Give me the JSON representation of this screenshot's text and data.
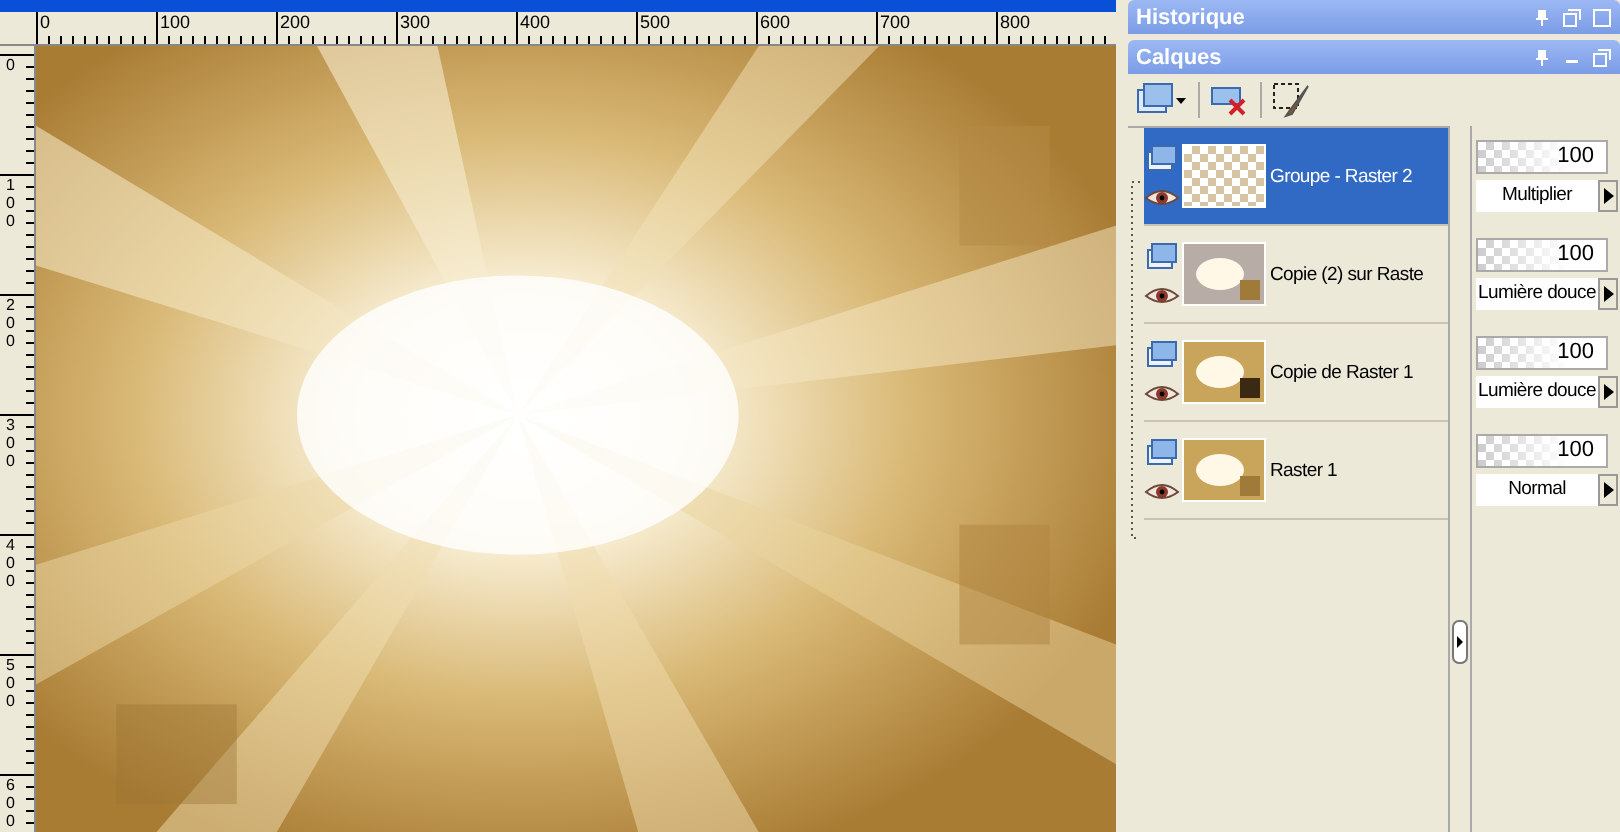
{
  "ruler_horizontal": {
    "labels": [
      "0",
      "100",
      "200",
      "300",
      "400",
      "500",
      "600",
      "700",
      "800"
    ]
  },
  "ruler_vertical": {
    "labels": [
      "0",
      "100",
      "200",
      "300",
      "400",
      "500",
      "600"
    ]
  },
  "palettes": [
    {
      "title": "Historique"
    },
    {
      "title": "Calques"
    }
  ],
  "layers": [
    {
      "name": "Groupe - Raster 2",
      "selected": true,
      "kind": "group",
      "opacity": "100",
      "blend_mode": "Multiplier"
    },
    {
      "name": "Copie (2) sur Raste",
      "selected": false,
      "kind": "raster",
      "opacity": "100",
      "blend_mode": "Lumière douce"
    },
    {
      "name": "Copie de Raster 1",
      "selected": false,
      "kind": "raster",
      "opacity": "100",
      "blend_mode": "Lumière douce"
    },
    {
      "name": "Raster 1",
      "selected": false,
      "kind": "raster",
      "opacity": "100",
      "blend_mode": "Normal"
    }
  ]
}
